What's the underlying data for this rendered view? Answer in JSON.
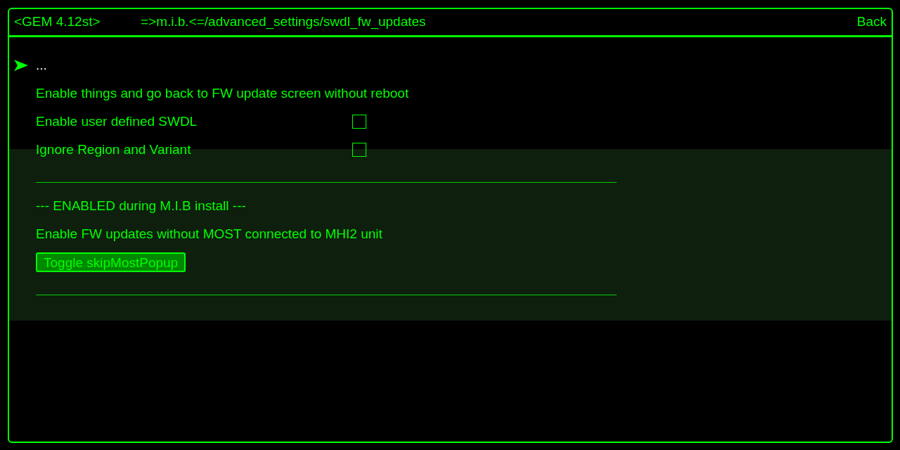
{
  "header": {
    "version": "<GEM 4.12st>",
    "path": "=>m.i.b.<=/advanced_settings/swdl_fw_updates",
    "back": "Back"
  },
  "items": [
    {
      "kind": "link",
      "label": "...",
      "selected": true
    },
    {
      "kind": "link",
      "label": "Enable things and go back to FW update screen without reboot",
      "selected": false
    },
    {
      "kind": "checkbox",
      "label": "Enable user defined SWDL",
      "checked": false,
      "selected": false
    },
    {
      "kind": "checkbox",
      "label": "Ignore Region and Variant",
      "checked": false,
      "selected": false
    },
    {
      "kind": "divider"
    },
    {
      "kind": "text",
      "label": "--- ENABLED during M.I.B install ---",
      "selected": false
    },
    {
      "kind": "text",
      "label": "Enable FW updates without MOST connected to MHI2 unit",
      "selected": false
    },
    {
      "kind": "button",
      "label": "Toggle skipMostPopup",
      "selected": false
    },
    {
      "kind": "divider"
    }
  ]
}
